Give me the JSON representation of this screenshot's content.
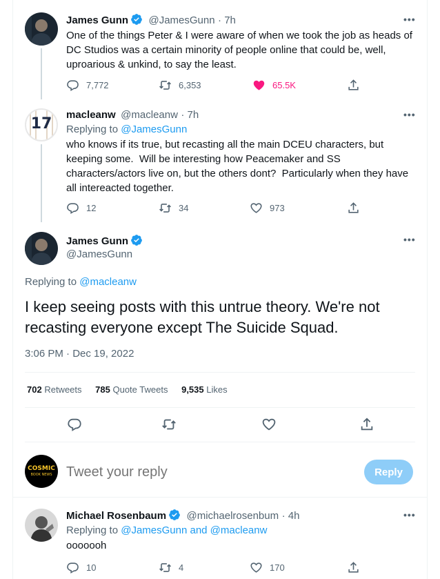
{
  "tweet1": {
    "name": "James Gunn",
    "handle": "@JamesGunn",
    "time": "· 7h",
    "text": "One of the things Peter & I were aware of when we took the job as heads of DC Studios was a certain minority of people online that could be, well, uproarious & unkind, to say the least.",
    "replies": "7,772",
    "retweets": "6,353",
    "likes": "65.5K",
    "liked_color": "#f91880"
  },
  "tweet2": {
    "name": "macleanw",
    "handle": "@macleanw",
    "time": "· 7h",
    "avatar_text": "17",
    "replying_prefix": "Replying to",
    "replying_to": "@JamesGunn",
    "text": "who knows if its true, but recasting all the main DCEU characters, but keeping some.  Will be interesting how Peacemaker and SS characters/actors live on, but the others dont?  Particularly when they have all intereacted together.",
    "replies": "12",
    "retweets": "34",
    "likes": "973"
  },
  "main_tweet": {
    "name": "James Gunn",
    "handle": "@JamesGunn",
    "replying_prefix": "Replying to",
    "replying_to": "@macleanw",
    "text": "I keep seeing posts with this untrue theory. We're not recasting everyone except The Suicide Squad.",
    "timestamp": "3:06 PM · Dec 19, 2022",
    "retweets_count": "702",
    "retweets_label": "Retweets",
    "quotes_count": "785",
    "quotes_label": "Quote Tweets",
    "likes_count": "9,535",
    "likes_label": "Likes"
  },
  "compose": {
    "avatar_line1": "COSMIC",
    "avatar_line2": "BOOK NEWS",
    "placeholder": "Tweet your reply",
    "reply_label": "Reply"
  },
  "tweet3": {
    "name": "Michael Rosenbaum",
    "handle": "@michaelrosenbum",
    "time": "· 4h",
    "replying_prefix": "Replying to",
    "replying_to": "@JamesGunn and @macleanw",
    "text": "ooooooh",
    "replies": "10",
    "retweets": "4",
    "likes": "170"
  },
  "colors": {
    "accent": "#1d9bf0",
    "text_secondary": "#536471",
    "like_active": "#f91880"
  },
  "icons": [
    "verified-icon",
    "more-icon",
    "reply-icon",
    "retweet-icon",
    "like-icon",
    "share-icon"
  ]
}
